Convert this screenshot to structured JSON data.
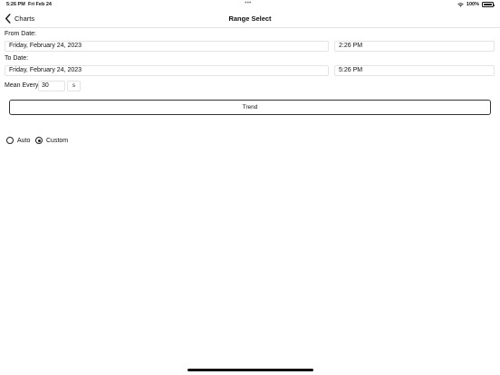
{
  "status_bar": {
    "time": "5:26 PM",
    "date": "Fri Feb 24",
    "dots": "•••",
    "battery_text": "100%"
  },
  "nav": {
    "back_label": "Charts",
    "title": "Range Select"
  },
  "form": {
    "from_label": "From Date:",
    "from_date": "Friday, February 24, 2023",
    "from_time": "2:26 PM",
    "to_label": "To Date:",
    "to_date": "Friday, February 24, 2023",
    "to_time": "5:26 PM",
    "mean_label": "Mean Every",
    "mean_value": "30",
    "mean_unit": "s",
    "trend_label": "Trend",
    "radio_auto": "Auto",
    "radio_custom": "Custom",
    "selected_mode": "Custom"
  },
  "icons": {
    "back": "chevron-left-icon",
    "wifi": "wifi-icon",
    "battery": "battery-icon"
  }
}
